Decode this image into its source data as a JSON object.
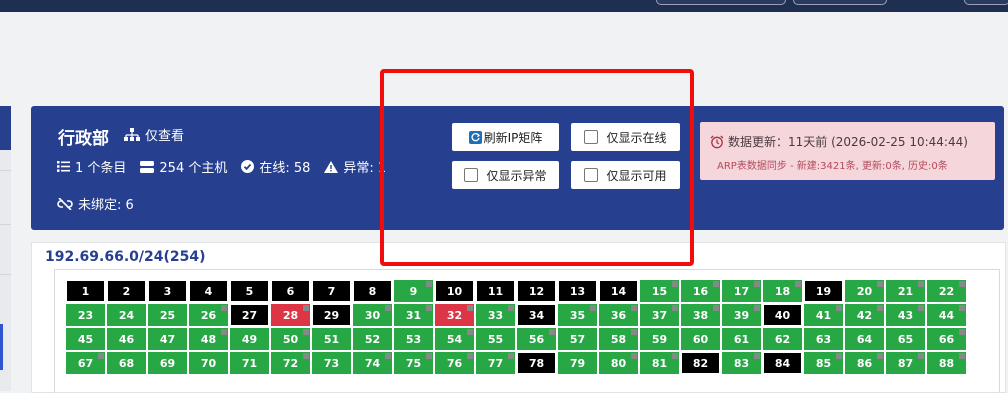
{
  "header": {
    "department": "行政部",
    "view_label": "仅查看",
    "stats": [
      {
        "icon": "list-icon",
        "text": "1 个条目"
      },
      {
        "icon": "server-icon",
        "text": "254 个主机"
      },
      {
        "icon": "check-circle-icon",
        "text": "在线: 58"
      },
      {
        "icon": "warning-icon",
        "text": "异常: 1"
      }
    ],
    "unbound": "未绑定: 6"
  },
  "actions": {
    "refresh": "刷新IP矩阵",
    "only_online": "仅显示在线",
    "only_abnormal": "仅显示异常",
    "only_available": "仅显示可用"
  },
  "info": {
    "update_text": "数据更新：11天前 (2026-02-25 10:44:44)",
    "arp_text": "ARP表数据同步 - 新建:3421条, 更新:0条, 历史:0条"
  },
  "subnet": {
    "title": "192.69.66.0/24(254)"
  },
  "colors": {
    "online": "#28a745",
    "offline": "#000000",
    "abnormal": "#dc3545",
    "panel": "#263f8f"
  },
  "ip_grid": {
    "columns": 22,
    "cells": [
      {
        "n": "1",
        "s": "offline"
      },
      {
        "n": "2",
        "s": "offline"
      },
      {
        "n": "3",
        "s": "offline"
      },
      {
        "n": "4",
        "s": "offline"
      },
      {
        "n": "5",
        "s": "offline"
      },
      {
        "n": "6",
        "s": "offline"
      },
      {
        "n": "7",
        "s": "offline"
      },
      {
        "n": "8",
        "s": "offline"
      },
      {
        "n": "9",
        "s": "online",
        "m": true
      },
      {
        "n": "10",
        "s": "offline"
      },
      {
        "n": "11",
        "s": "offline"
      },
      {
        "n": "12",
        "s": "offline"
      },
      {
        "n": "13",
        "s": "offline"
      },
      {
        "n": "14",
        "s": "offline"
      },
      {
        "n": "15",
        "s": "online",
        "m": true
      },
      {
        "n": "16",
        "s": "online",
        "m": true
      },
      {
        "n": "17",
        "s": "online",
        "m": true
      },
      {
        "n": "18",
        "s": "online",
        "m": true
      },
      {
        "n": "19",
        "s": "offline"
      },
      {
        "n": "20",
        "s": "online",
        "m": true
      },
      {
        "n": "21",
        "s": "online",
        "m": true
      },
      {
        "n": "22",
        "s": "online",
        "m": true
      },
      {
        "n": "23",
        "s": "online"
      },
      {
        "n": "24",
        "s": "online"
      },
      {
        "n": "25",
        "s": "online"
      },
      {
        "n": "26",
        "s": "online",
        "m": true
      },
      {
        "n": "27",
        "s": "offline"
      },
      {
        "n": "28",
        "s": "abnormal",
        "m": true
      },
      {
        "n": "29",
        "s": "offline"
      },
      {
        "n": "30",
        "s": "online",
        "m": true
      },
      {
        "n": "31",
        "s": "online",
        "m": true
      },
      {
        "n": "32",
        "s": "abnormal",
        "m": true
      },
      {
        "n": "33",
        "s": "online",
        "m": true
      },
      {
        "n": "34",
        "s": "offline"
      },
      {
        "n": "35",
        "s": "online",
        "m": true
      },
      {
        "n": "36",
        "s": "online",
        "m": true
      },
      {
        "n": "37",
        "s": "online",
        "m": true
      },
      {
        "n": "38",
        "s": "online",
        "m": true
      },
      {
        "n": "39",
        "s": "online",
        "m": true
      },
      {
        "n": "40",
        "s": "offline"
      },
      {
        "n": "41",
        "s": "online",
        "m": true
      },
      {
        "n": "42",
        "s": "online",
        "m": true
      },
      {
        "n": "43",
        "s": "online",
        "m": true
      },
      {
        "n": "44",
        "s": "online",
        "m": true
      },
      {
        "n": "45",
        "s": "online"
      },
      {
        "n": "46",
        "s": "online"
      },
      {
        "n": "47",
        "s": "online"
      },
      {
        "n": "48",
        "s": "online",
        "m": true
      },
      {
        "n": "49",
        "s": "online"
      },
      {
        "n": "50",
        "s": "online",
        "m": true
      },
      {
        "n": "51",
        "s": "online"
      },
      {
        "n": "52",
        "s": "online"
      },
      {
        "n": "53",
        "s": "online"
      },
      {
        "n": "54",
        "s": "online",
        "m": true
      },
      {
        "n": "55",
        "s": "online"
      },
      {
        "n": "56",
        "s": "online",
        "m": true
      },
      {
        "n": "57",
        "s": "online"
      },
      {
        "n": "58",
        "s": "online",
        "m": true
      },
      {
        "n": "59",
        "s": "online"
      },
      {
        "n": "60",
        "s": "online"
      },
      {
        "n": "61",
        "s": "online"
      },
      {
        "n": "62",
        "s": "online"
      },
      {
        "n": "63",
        "s": "online"
      },
      {
        "n": "64",
        "s": "online"
      },
      {
        "n": "65",
        "s": "online"
      },
      {
        "n": "66",
        "s": "online",
        "m": true
      },
      {
        "n": "67",
        "s": "online",
        "m": true
      },
      {
        "n": "68",
        "s": "online"
      },
      {
        "n": "69",
        "s": "online"
      },
      {
        "n": "70",
        "s": "online"
      },
      {
        "n": "71",
        "s": "online"
      },
      {
        "n": "72",
        "s": "online",
        "m": true
      },
      {
        "n": "73",
        "s": "online"
      },
      {
        "n": "74",
        "s": "online",
        "m": true
      },
      {
        "n": "75",
        "s": "online",
        "m": true
      },
      {
        "n": "76",
        "s": "online",
        "m": true
      },
      {
        "n": "77",
        "s": "online",
        "m": true
      },
      {
        "n": "78",
        "s": "offline"
      },
      {
        "n": "79",
        "s": "online"
      },
      {
        "n": "80",
        "s": "online",
        "m": true
      },
      {
        "n": "81",
        "s": "online",
        "m": true
      },
      {
        "n": "82",
        "s": "offline"
      },
      {
        "n": "83",
        "s": "online",
        "m": true
      },
      {
        "n": "84",
        "s": "offline"
      },
      {
        "n": "85",
        "s": "online",
        "m": true
      },
      {
        "n": "86",
        "s": "online",
        "m": true
      },
      {
        "n": "87",
        "s": "online",
        "m": true
      },
      {
        "n": "88",
        "s": "online",
        "m": true
      }
    ]
  }
}
